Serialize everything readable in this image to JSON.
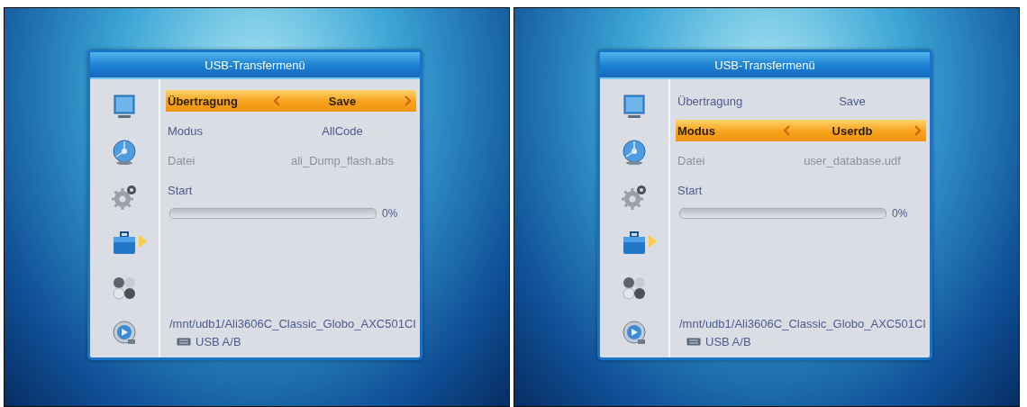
{
  "screens": [
    {
      "title": "USB-Transfermenü",
      "sidebar": [
        {
          "kind": "monitor",
          "selected": false
        },
        {
          "kind": "disc",
          "selected": false
        },
        {
          "kind": "gear",
          "selected": false
        },
        {
          "kind": "toolbox",
          "selected": true
        },
        {
          "kind": "dots",
          "selected": false
        },
        {
          "kind": "media",
          "selected": false
        }
      ],
      "rows": [
        {
          "kind": "option",
          "label": "Übertragung",
          "value": "Save",
          "selected": true,
          "disabled": false
        },
        {
          "kind": "option",
          "label": "Modus",
          "value": "AllCode",
          "selected": false,
          "disabled": false
        },
        {
          "kind": "option",
          "label": "Datei",
          "value": "ali_Dump_flash.abs",
          "selected": false,
          "disabled": true
        },
        {
          "kind": "action",
          "label": "Start",
          "selected": false,
          "disabled": false
        }
      ],
      "progress": {
        "level": 0,
        "reading": "0%"
      },
      "path": "/mnt/udb1/Ali3606C_Classic_Globo_AXC501CI",
      "footer": "USB A/B"
    },
    {
      "title": "USB-Transfermenü",
      "sidebar": [
        {
          "kind": "monitor",
          "selected": false
        },
        {
          "kind": "disc",
          "selected": false
        },
        {
          "kind": "gear",
          "selected": false
        },
        {
          "kind": "toolbox",
          "selected": true
        },
        {
          "kind": "dots",
          "selected": false
        },
        {
          "kind": "media",
          "selected": false
        }
      ],
      "rows": [
        {
          "kind": "option",
          "label": "Übertragung",
          "value": "Save",
          "selected": false,
          "disabled": false
        },
        {
          "kind": "option",
          "label": "Modus",
          "value": "Userdb",
          "selected": true,
          "disabled": false
        },
        {
          "kind": "option",
          "label": "Datei",
          "value": "user_database.udf",
          "selected": false,
          "disabled": true
        },
        {
          "kind": "action",
          "label": "Start",
          "selected": false,
          "disabled": false
        }
      ],
      "progress": {
        "level": 0,
        "reading": "0%"
      },
      "path": "/mnt/udb1/Ali3606C_Classic_Globo_AXC501CI",
      "footer": "USB A/B"
    }
  ]
}
